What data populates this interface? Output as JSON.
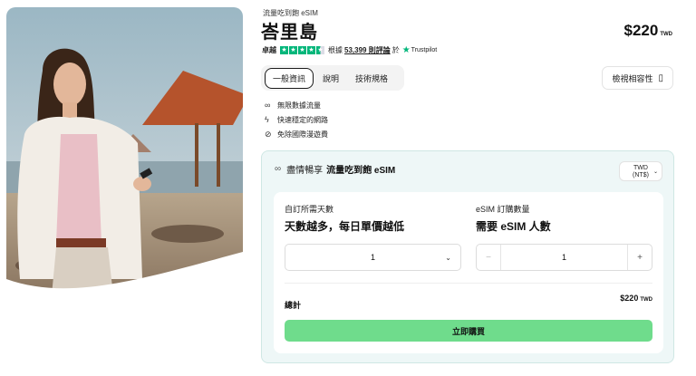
{
  "product": {
    "kicker": "流量吃到飽 eSIM",
    "title": "峇里島",
    "price": "$220",
    "price_currency": "TWD"
  },
  "rating": {
    "word": "卓越",
    "stars": 4.5,
    "prefix": "根據",
    "count": "53,399 則評論",
    "suffix": "於",
    "source": "Trustpilot"
  },
  "tabs": [
    {
      "label": "一般資訊",
      "active": true
    },
    {
      "label": "說明",
      "active": false
    },
    {
      "label": "技術規格",
      "active": false
    }
  ],
  "compat_button": {
    "label": "檢視相容性",
    "icon": "phone-check-icon"
  },
  "features": [
    {
      "icon": "infinity-icon",
      "label": "無限數據流量"
    },
    {
      "icon": "lightning-icon",
      "label": "快速穩定的網路"
    },
    {
      "icon": "no-roaming-icon",
      "label": "免除國際漫遊費"
    }
  ],
  "panel": {
    "header_prefix": "盡情暢享",
    "header_strong": "流量吃到飽 eSIM",
    "currency_line1": "TWD",
    "currency_line2": "(NT$)",
    "days": {
      "label": "自訂所需天數",
      "headline": "天數越多，每日單價越低",
      "value": "1"
    },
    "quantity": {
      "label": "eSIM 訂購數量",
      "headline": "需要 eSIM 人數",
      "value": "1",
      "minus": "−",
      "plus": "+"
    },
    "total_label": "總計",
    "total_value": "$220",
    "total_currency": "TWD",
    "buy_label": "立即購買"
  },
  "colors": {
    "accent_green": "#6fdc8c",
    "trustpilot_green": "#00b67a",
    "panel_bg": "#eef7f7"
  }
}
